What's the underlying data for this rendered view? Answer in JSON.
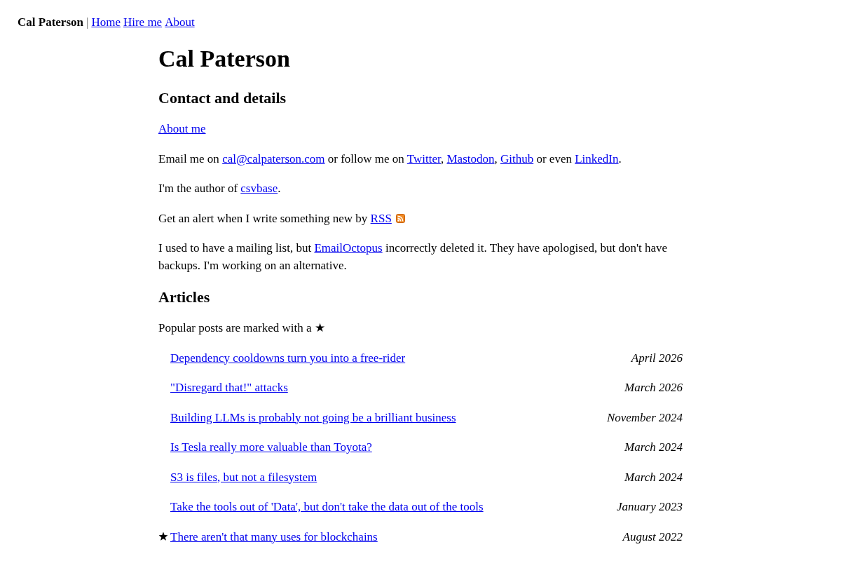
{
  "nav": {
    "site_name": "Cal Paterson",
    "separator": "|",
    "links": [
      "Home",
      "Hire me",
      "About"
    ]
  },
  "page_title": "Cal Paterson",
  "contact": {
    "heading": "Contact and details",
    "paragraphs": [
      {
        "kind": "plain",
        "parts": [
          {
            "kind": "link",
            "text": "About me"
          }
        ]
      },
      {
        "kind": "plain",
        "parts": [
          {
            "kind": "text",
            "text": "Email me on "
          },
          {
            "kind": "link",
            "text": "cal@calpaterson.com"
          },
          {
            "kind": "text",
            "text": " or follow me on "
          },
          {
            "kind": "link",
            "text": "Twitter"
          },
          {
            "kind": "text",
            "text": ", "
          },
          {
            "kind": "link",
            "text": "Mastodon"
          },
          {
            "kind": "text",
            "text": ", "
          },
          {
            "kind": "link",
            "text": "Github"
          },
          {
            "kind": "text",
            "text": " or even "
          },
          {
            "kind": "link",
            "text": "LinkedIn"
          },
          {
            "kind": "text",
            "text": "."
          }
        ]
      },
      {
        "kind": "plain",
        "parts": [
          {
            "kind": "text",
            "text": "I'm the author of "
          },
          {
            "kind": "link",
            "text": "csvbase"
          },
          {
            "kind": "text",
            "text": "."
          }
        ]
      },
      {
        "kind": "feed",
        "parts": [
          {
            "kind": "text",
            "text": "Get an alert when I write something new by "
          },
          {
            "kind": "link",
            "text": "RSS"
          }
        ]
      },
      {
        "kind": "plain",
        "parts": [
          {
            "kind": "text",
            "text": "I used to have a mailing list, but "
          },
          {
            "kind": "link",
            "text": "EmailOctopus"
          },
          {
            "kind": "text",
            "text": " incorrectly deleted it. They have apologised, but don't have backups. I'm working on an alternative."
          }
        ]
      }
    ]
  },
  "articles": {
    "heading": "Articles",
    "note": "Popular posts are marked with a ★",
    "items": [
      {
        "title": "Dependency cooldowns turn you into a free-rider",
        "date": "April 2026",
        "popular": false
      },
      {
        "title": "\"Disregard that!\" attacks",
        "date": "March 2026",
        "popular": false
      },
      {
        "title": "Building LLMs is probably not going be a brilliant business",
        "date": "November 2024",
        "popular": false
      },
      {
        "title": "Is Tesla really more valuable than Toyota?",
        "date": "March 2024",
        "popular": false
      },
      {
        "title": "S3 is files, but not a filesystem",
        "date": "March 2024",
        "popular": false
      },
      {
        "title": "Take the tools out of 'Data', but don't take the data out of the tools",
        "date": "January 2023",
        "popular": false
      },
      {
        "title": "There aren't that many uses for blockchains",
        "date": "August 2022",
        "popular": true
      }
    ]
  }
}
